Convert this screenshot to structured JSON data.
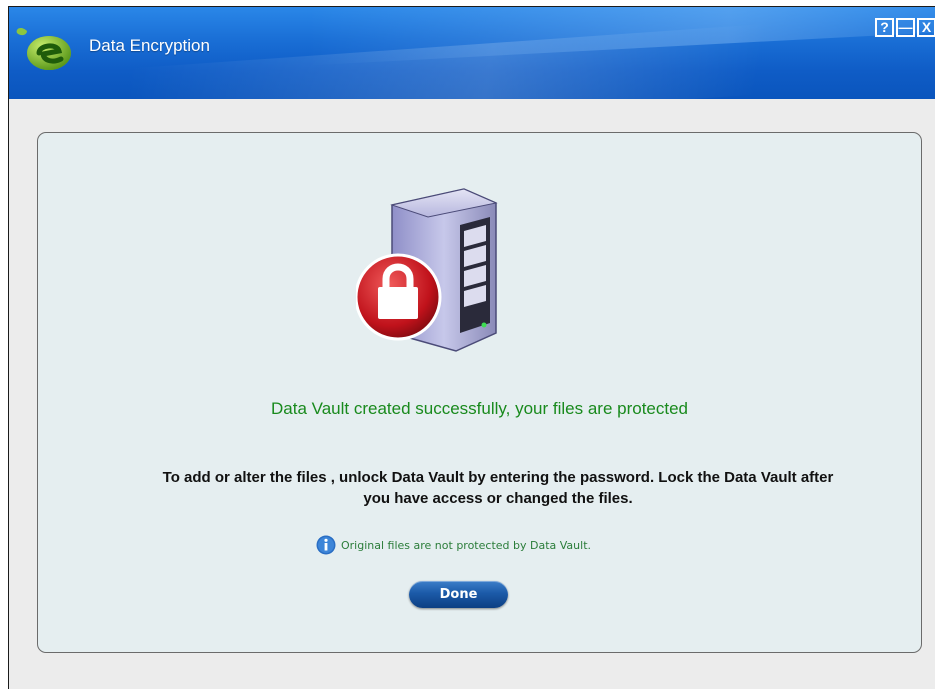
{
  "window": {
    "title": "Data Encryption",
    "controls": {
      "help": "?",
      "minimize": "—",
      "close": "X"
    }
  },
  "message": {
    "success": "Data Vault created successfully, your files are protected",
    "instructions": "To add or alter the files , unlock Data Vault by entering the password. Lock the Data Vault after you have access or changed the files.",
    "note": "Original files are not protected by Data Vault."
  },
  "actions": {
    "done_label": "Done"
  },
  "icons": {
    "app_logo": "leaf-e-logo-icon",
    "hero": "locked-server-icon",
    "note": "info-icon"
  },
  "colors": {
    "titlebar": "#1a6fd6",
    "success_text": "#198a1d",
    "note_text": "#2b7d3a",
    "button": "#1b5aa8",
    "panel": "#e5eef0"
  }
}
